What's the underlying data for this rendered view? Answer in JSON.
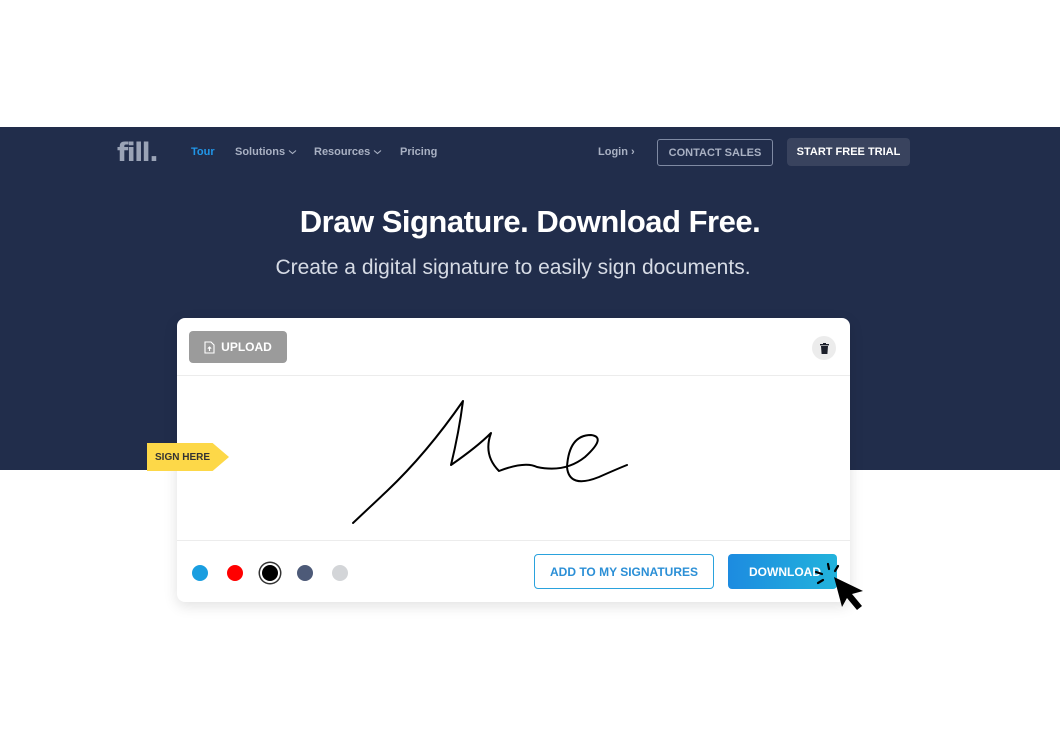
{
  "nav": {
    "logo": "fill.",
    "links": [
      {
        "label": "Tour",
        "active": true,
        "dropdown": false
      },
      {
        "label": "Solutions",
        "active": false,
        "dropdown": true
      },
      {
        "label": "Resources",
        "active": false,
        "dropdown": true
      },
      {
        "label": "Pricing",
        "active": false,
        "dropdown": false
      }
    ],
    "login_label": "Login ›",
    "contact_label": "CONTACT SALES",
    "trial_label": "START FREE TRIAL"
  },
  "hero": {
    "title": "Draw Signature. Download Free.",
    "subtitle": "Create a digital signature to easily sign documents."
  },
  "signature_card": {
    "upload_label": "UPLOAD",
    "upload_icon": "file-upload-icon",
    "delete_icon": "trash-icon",
    "sign_here_label": "SIGN HERE",
    "signature_text": "Me",
    "colors": [
      {
        "name": "blue",
        "hex": "#1a9ee0",
        "selected": false
      },
      {
        "name": "red",
        "hex": "#ff0000",
        "selected": false
      },
      {
        "name": "black",
        "hex": "#000000",
        "selected": true
      },
      {
        "name": "slate",
        "hex": "#4d5a78",
        "selected": false
      },
      {
        "name": "light-gray",
        "hex": "#d3d5d8",
        "selected": false
      }
    ],
    "add_label": "ADD TO MY SIGNATURES",
    "download_label": "DOWNLOAD"
  },
  "theme": {
    "hero_bg": "#212d4b",
    "accent": "#2196e8",
    "sign_here_bg": "#fdd848"
  }
}
